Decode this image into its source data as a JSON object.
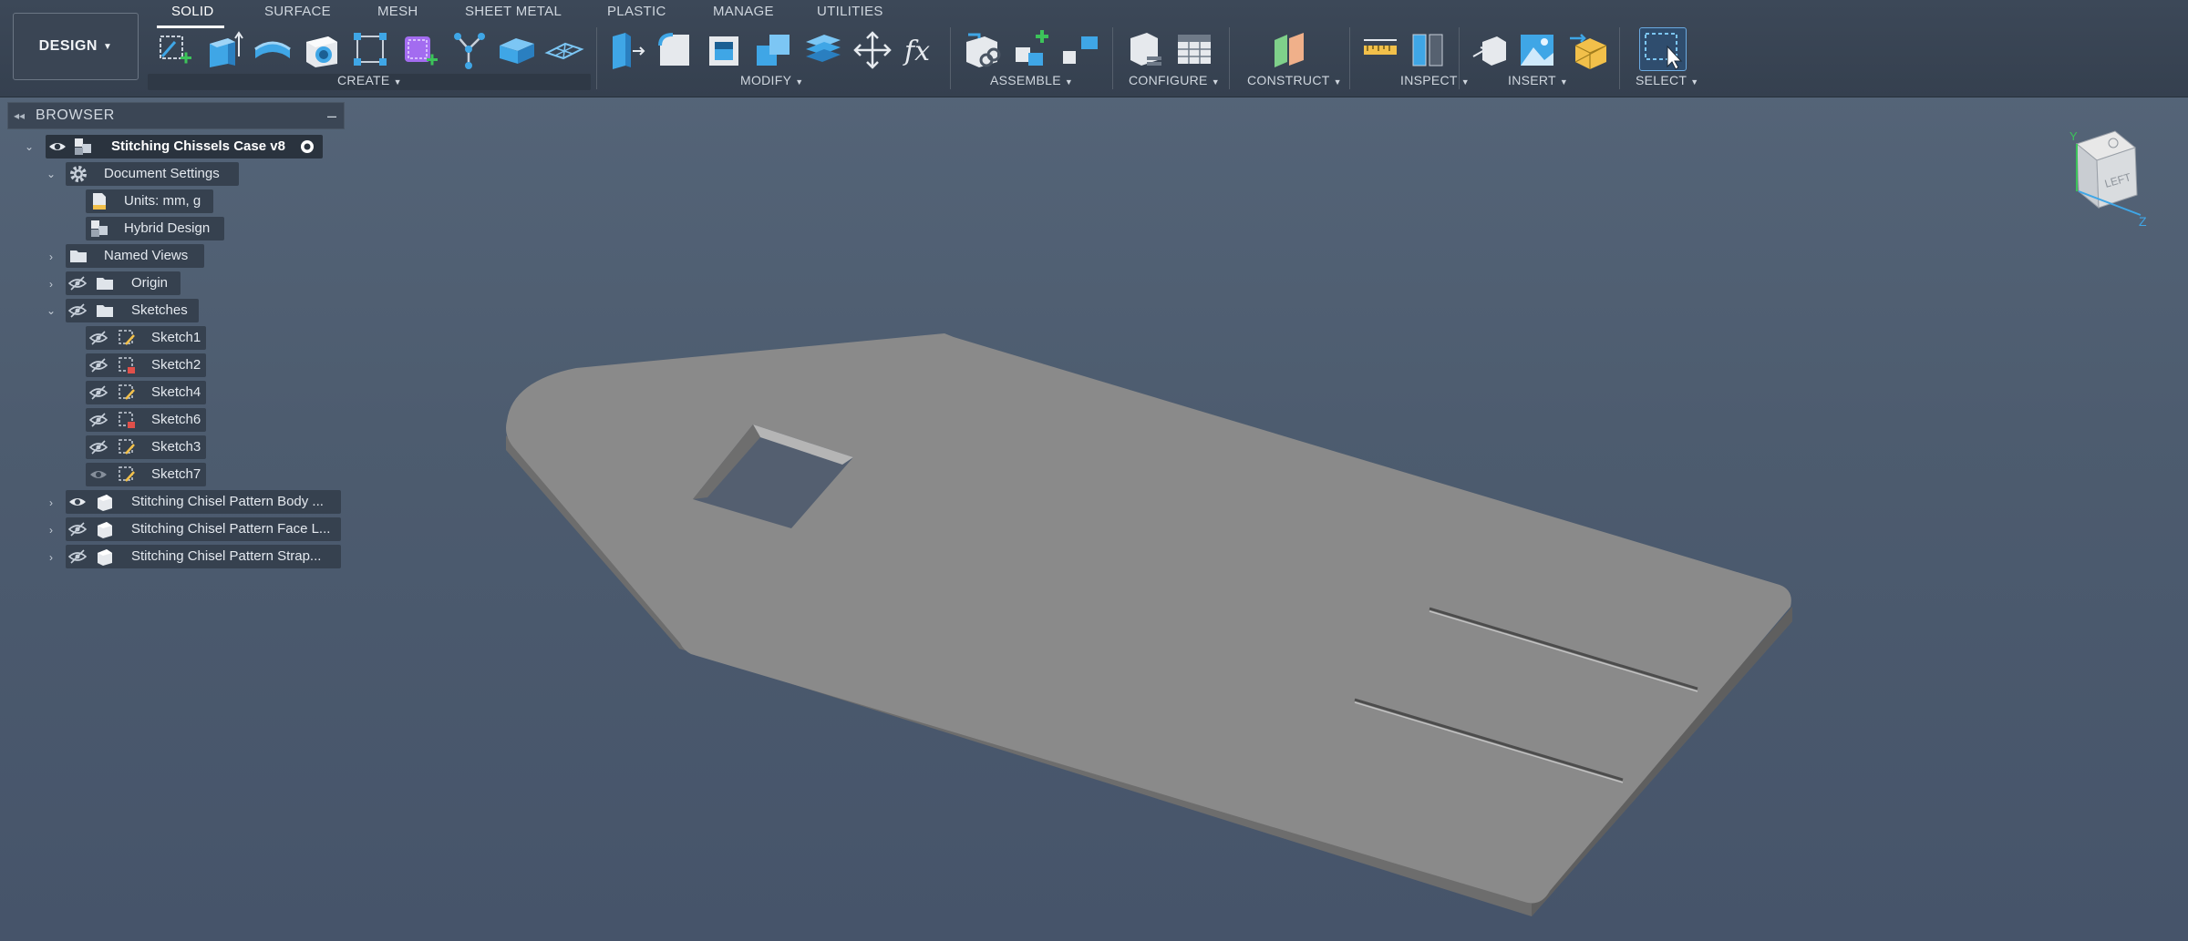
{
  "workspace": {
    "label": "DESIGN"
  },
  "tabs": [
    {
      "label": "SOLID",
      "active": true
    },
    {
      "label": "SURFACE"
    },
    {
      "label": "MESH"
    },
    {
      "label": "SHEET METAL"
    },
    {
      "label": "PLASTIC"
    },
    {
      "label": "MANAGE"
    },
    {
      "label": "UTILITIES"
    }
  ],
  "groups": {
    "create": "CREATE",
    "modify": "MODIFY",
    "assemble": "ASSEMBLE",
    "configure": "CONFIGURE",
    "construct": "CONSTRUCT",
    "inspect": "INSPECT",
    "insert": "INSERT",
    "select": "SELECT"
  },
  "icons": {
    "create": [
      "create-sketch-icon",
      "extrude-icon",
      "revolve-icon",
      "hole-icon",
      "rectangular-pattern-icon",
      "create-form-icon",
      "derive-icon",
      "box-icon",
      "mesh-plane-icon"
    ],
    "modify": [
      "press-pull-icon",
      "fillet-icon",
      "shell-icon",
      "combine-icon",
      "offset-face-icon",
      "move-icon",
      "parameters-icon"
    ],
    "assemble": [
      "new-component-icon",
      "joint-icon",
      "as-built-joint-icon"
    ],
    "configure": [
      "configure-icon",
      "configuration-table-icon"
    ],
    "construct": [
      "offset-plane-icon"
    ],
    "inspect": [
      "measure-icon",
      "section-analysis-icon"
    ],
    "insert": [
      "insert-derive-icon",
      "decal-icon",
      "insert-mesh-icon"
    ],
    "select": [
      "window-select-icon"
    ]
  },
  "colors": {
    "accent_blue": "#3fa6e6",
    "create_green": "#3cc35a",
    "form_purple": "#a36cf0",
    "body_gray": "#8a8a8a",
    "viewport_bg": "#4f5e71"
  },
  "browser": {
    "title": "BROWSER",
    "root": "Stitching Chissels Case v8",
    "document_settings": "Document Settings",
    "units": "Units: mm, g",
    "hybrid_design": "Hybrid Design",
    "named_views": "Named Views",
    "origin": "Origin",
    "sketches": "Sketches",
    "sketch_list": [
      "Sketch1",
      "Sketch2",
      "Sketch4",
      "Sketch6",
      "Sketch3",
      "Sketch7"
    ],
    "bodies": [
      "Stitching Chisel Pattern Body ...",
      "Stitching Chisel Pattern Face L...",
      "Stitching Chisel Pattern Strap..."
    ]
  },
  "viewcube": {
    "face": "LEFT",
    "axis_y": "Y",
    "axis_z": "Z"
  }
}
